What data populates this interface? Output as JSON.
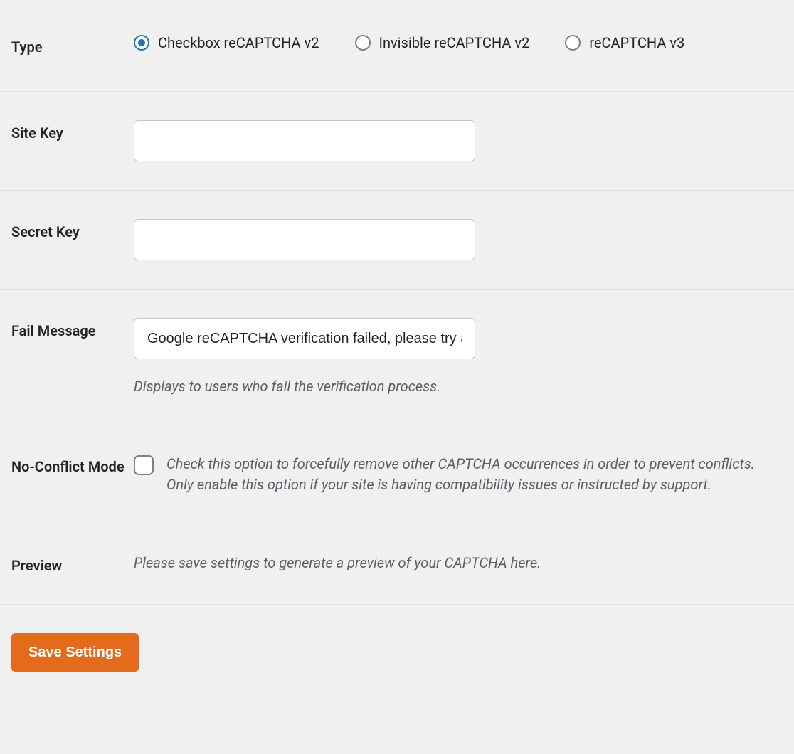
{
  "rows": {
    "type": {
      "label": "Type",
      "options": [
        {
          "label": "Checkbox reCAPTCHA v2",
          "checked": true
        },
        {
          "label": "Invisible reCAPTCHA v2",
          "checked": false
        },
        {
          "label": "reCAPTCHA v3",
          "checked": false
        }
      ]
    },
    "site_key": {
      "label": "Site Key",
      "value": ""
    },
    "secret_key": {
      "label": "Secret Key",
      "value": ""
    },
    "fail_message": {
      "label": "Fail Message",
      "value": "Google reCAPTCHA verification failed, please try again later.",
      "help": "Displays to users who fail the verification process."
    },
    "no_conflict": {
      "label": "No-Conflict Mode",
      "checked": false,
      "description": "Check this option to forcefully remove other CAPTCHA occurrences in order to prevent conflicts. Only enable this option if your site is having compatibility issues or instructed by support."
    },
    "preview": {
      "label": "Preview",
      "text": "Please save settings to generate a preview of your CAPTCHA here."
    }
  },
  "save_button": "Save Settings"
}
